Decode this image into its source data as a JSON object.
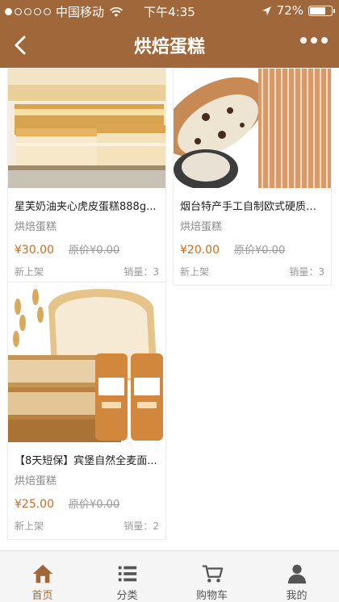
{
  "status_bar": {
    "carrier": "中国移动",
    "time": "下午4:35",
    "battery": "72%",
    "battery_level": 0.72
  },
  "nav": {
    "title": "烘焙蛋糕"
  },
  "products": [
    {
      "name": "星芙奶油夹心虎皮蛋糕888g...",
      "category": "烘焙蛋糕",
      "price": "¥30.00",
      "original_price": "原价¥0.00",
      "tag": "新上架",
      "sales": "销量：3"
    },
    {
      "name": "烟台特产手工自制欧式硬质木...",
      "category": "烘焙蛋糕",
      "price": "¥20.00",
      "original_price": "原价¥0.00",
      "tag": "新上架",
      "sales": "销量：3"
    },
    {
      "name": "【8天短保】宾堡自然全麦面...",
      "category": "烘焙蛋糕",
      "price": "¥25.00",
      "original_price": "原价¥0.00",
      "tag": "新上架",
      "sales": "销量：2"
    }
  ],
  "tabbar": [
    {
      "label": "首页",
      "icon": "home-icon"
    },
    {
      "label": "分类",
      "icon": "list-icon"
    },
    {
      "label": "购物车",
      "icon": "cart-icon"
    },
    {
      "label": "我的",
      "icon": "user-icon"
    }
  ],
  "colors": {
    "brand": "#a0673a",
    "price": "#c36d28"
  }
}
